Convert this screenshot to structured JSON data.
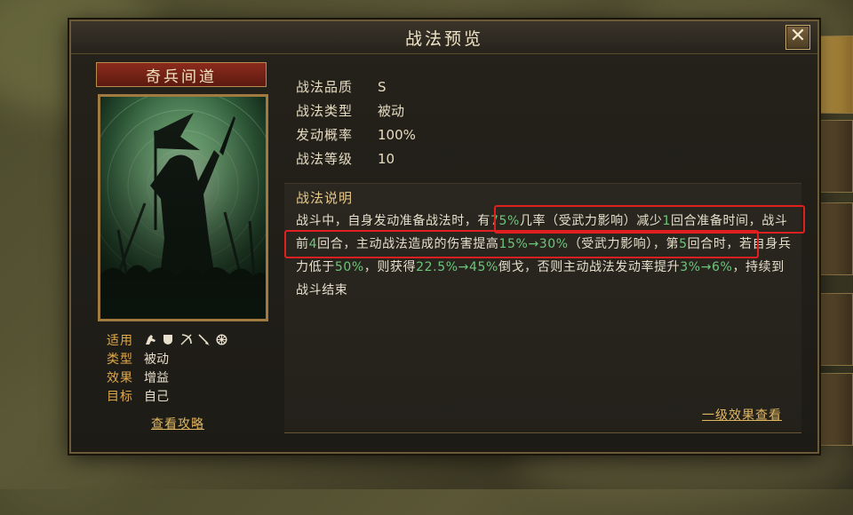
{
  "dialog": {
    "title": "战法预览",
    "close_label": "✕"
  },
  "skill": {
    "name": "奇兵间道"
  },
  "info": [
    {
      "key": "战法品质",
      "value": "S"
    },
    {
      "key": "战法类型",
      "value": "被动"
    },
    {
      "key": "发动概率",
      "value": "100%"
    },
    {
      "key": "战法等级",
      "value": "10"
    }
  ],
  "attrs": {
    "apply_label": "适用",
    "apply_icons": [
      "cavalry-icon",
      "shield-icon",
      "bow-icon",
      "spear-icon",
      "wheel-icon"
    ],
    "type_label": "类型",
    "type_value": "被动",
    "effect_label": "效果",
    "effect_value": "增益",
    "target_label": "目标",
    "target_value": "自己"
  },
  "links": {
    "strategy": "查看攻略",
    "level_effects": "一级效果查看"
  },
  "description": {
    "title": "战法说明",
    "segments": [
      {
        "t": "战斗中，自身发动准备战法时，有",
        "c": "n"
      },
      {
        "t": "75%",
        "c": "g"
      },
      {
        "t": "几率（受武力影响）减少",
        "c": "n"
      },
      {
        "t": "1",
        "c": "g"
      },
      {
        "t": "回合准备时间，战斗前",
        "c": "n"
      },
      {
        "t": "4",
        "c": "g"
      },
      {
        "t": "回合，主动战法造成的伤害提高",
        "c": "n"
      },
      {
        "t": "15%→30%",
        "c": "g"
      },
      {
        "t": "（受武力影响），第",
        "c": "n"
      },
      {
        "t": "5",
        "c": "g"
      },
      {
        "t": "回合时，若自身兵力低于",
        "c": "n"
      },
      {
        "t": "50%",
        "c": "g"
      },
      {
        "t": "，则获得",
        "c": "n"
      },
      {
        "t": "22.5%→45%",
        "c": "g"
      },
      {
        "t": "倒戈，否则主动战法发动率提升",
        "c": "n"
      },
      {
        "t": "3%→6%",
        "c": "g"
      },
      {
        "t": "，持续到战斗结束",
        "c": "n"
      }
    ]
  },
  "colors": {
    "highlight": "#6bc77b",
    "annotation_box": "#e02020",
    "accent": "#e0a94a"
  }
}
